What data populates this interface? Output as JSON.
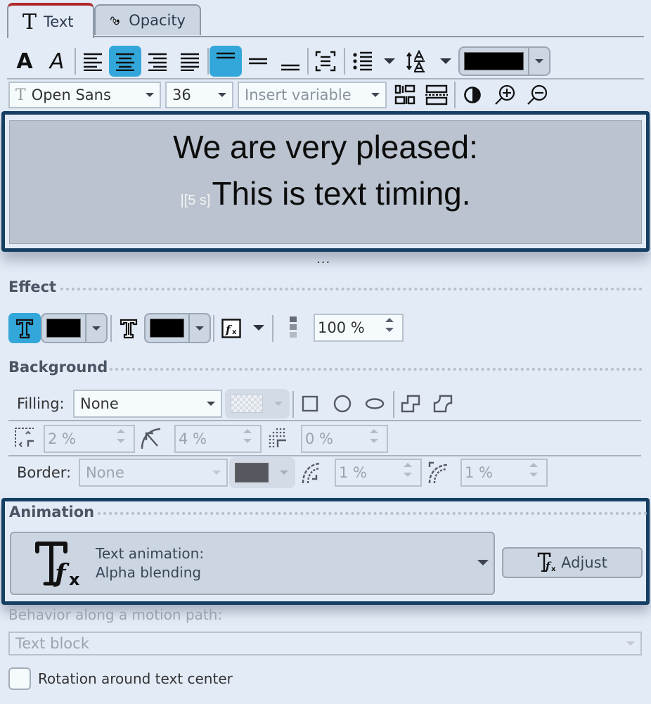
{
  "tabs": [
    {
      "label": "Text",
      "icon": "text-T-icon",
      "active": true
    },
    {
      "label": "Opacity",
      "icon": "opacity-curve-icon",
      "active": false
    }
  ],
  "toolbar1": {
    "bold": "A",
    "italic": "A",
    "align": [
      "left",
      "center",
      "right",
      "justify"
    ],
    "align_selected": "center",
    "valign": [
      "top",
      "middle",
      "bottom"
    ],
    "valign_selected": "top",
    "text_color": "#000000"
  },
  "toolbar2": {
    "font": "Open Sans",
    "size": "36",
    "variable_placeholder": "Insert variable"
  },
  "preview": {
    "line1": "We are very pleased:",
    "timing_marker": "|[5 s]",
    "line2": "This is text timing.",
    "background": "#bac3cf"
  },
  "splitter": "...",
  "effect": {
    "title": "Effect",
    "fill_color": "#000000",
    "outline_color": "#000000",
    "opacity": "100 %"
  },
  "background": {
    "title": "Background",
    "filling_label": "Filling:",
    "filling_value": "None",
    "padding": "2 %",
    "corner_radius": "4 %",
    "softness": "0 %",
    "border_label": "Border:",
    "border_value": "None",
    "border_color": "#55595f",
    "border_width": "1 %",
    "border_radius": "1 %"
  },
  "animation": {
    "title": "Animation",
    "select_label": "Text animation:",
    "select_value": "Alpha blending",
    "adjust_label": "Adjust"
  },
  "motion_path": {
    "label": "Behavior along a motion path:",
    "value": "Text block"
  },
  "rotation_checkbox": {
    "label": "Rotation around text center",
    "checked": false
  },
  "colors": {
    "accent": "#33a7d9",
    "frame": "#153e63",
    "active_tab_top": "#b02a2a"
  }
}
